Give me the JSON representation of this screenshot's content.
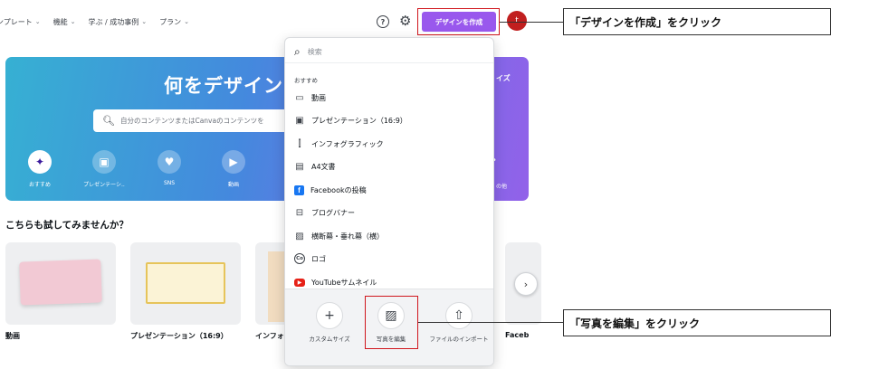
{
  "nav": {
    "items": [
      "テンプレート",
      "機能",
      "学ぶ / 成功事例",
      "プラン"
    ]
  },
  "header": {
    "help_icon": "help-circle-icon",
    "settings_icon": "gear-icon",
    "create_button": "デザインを作成",
    "avatar_initial": "t"
  },
  "hero": {
    "title": "何をデザインし",
    "side_text": "イズ",
    "search_placeholder": "自分のコンテンツまたはCanvaのコンテンツを",
    "categories": [
      {
        "label": "おすすめ",
        "icon": "sparkle-icon"
      },
      {
        "label": "プレゼンテーシ..",
        "icon": "presentation-icon"
      },
      {
        "label": "SNS",
        "icon": "heart-chat-icon"
      },
      {
        "label": "動画",
        "icon": "video-icon"
      }
    ],
    "more_label": "の他"
  },
  "try_section": {
    "title": "こちらも試してみませんか？",
    "cards": [
      "動画",
      "プレゼンテーション（16:9）",
      "インフォ",
      "Faceb"
    ]
  },
  "dropdown": {
    "search_placeholder": "検索",
    "section_title": "おすすめ",
    "items": [
      {
        "label": "動画",
        "icon": "video-icon"
      },
      {
        "label": "プレゼンテーション（16:9）",
        "icon": "presentation-icon"
      },
      {
        "label": "インフォグラフィック",
        "icon": "chart-icon"
      },
      {
        "label": "A4文書",
        "icon": "document-icon"
      },
      {
        "label": "Facebookの投稿",
        "icon": "facebook-icon"
      },
      {
        "label": "ブログバナー",
        "icon": "banner-icon"
      },
      {
        "label": "横断幕・垂れ幕（横）",
        "icon": "image-icon"
      },
      {
        "label": "ロゴ",
        "icon": "logo-icon"
      },
      {
        "label": "YouTubeサムネイル",
        "icon": "youtube-icon"
      }
    ],
    "actions": [
      {
        "label": "カスタムサイズ",
        "icon": "plus-icon"
      },
      {
        "label": "写真を編集",
        "icon": "photo-edit-icon"
      },
      {
        "label": "ファイルのインポート",
        "icon": "upload-icon"
      }
    ]
  },
  "annotations": {
    "create_callout": "「デザインを作成」をクリック",
    "photo_callout": "「写真を編集」をクリック"
  },
  "colors": {
    "brand_purple": "#7d2ae8",
    "highlight_red": "#d0161d",
    "avatar_red": "#c11f1f"
  }
}
